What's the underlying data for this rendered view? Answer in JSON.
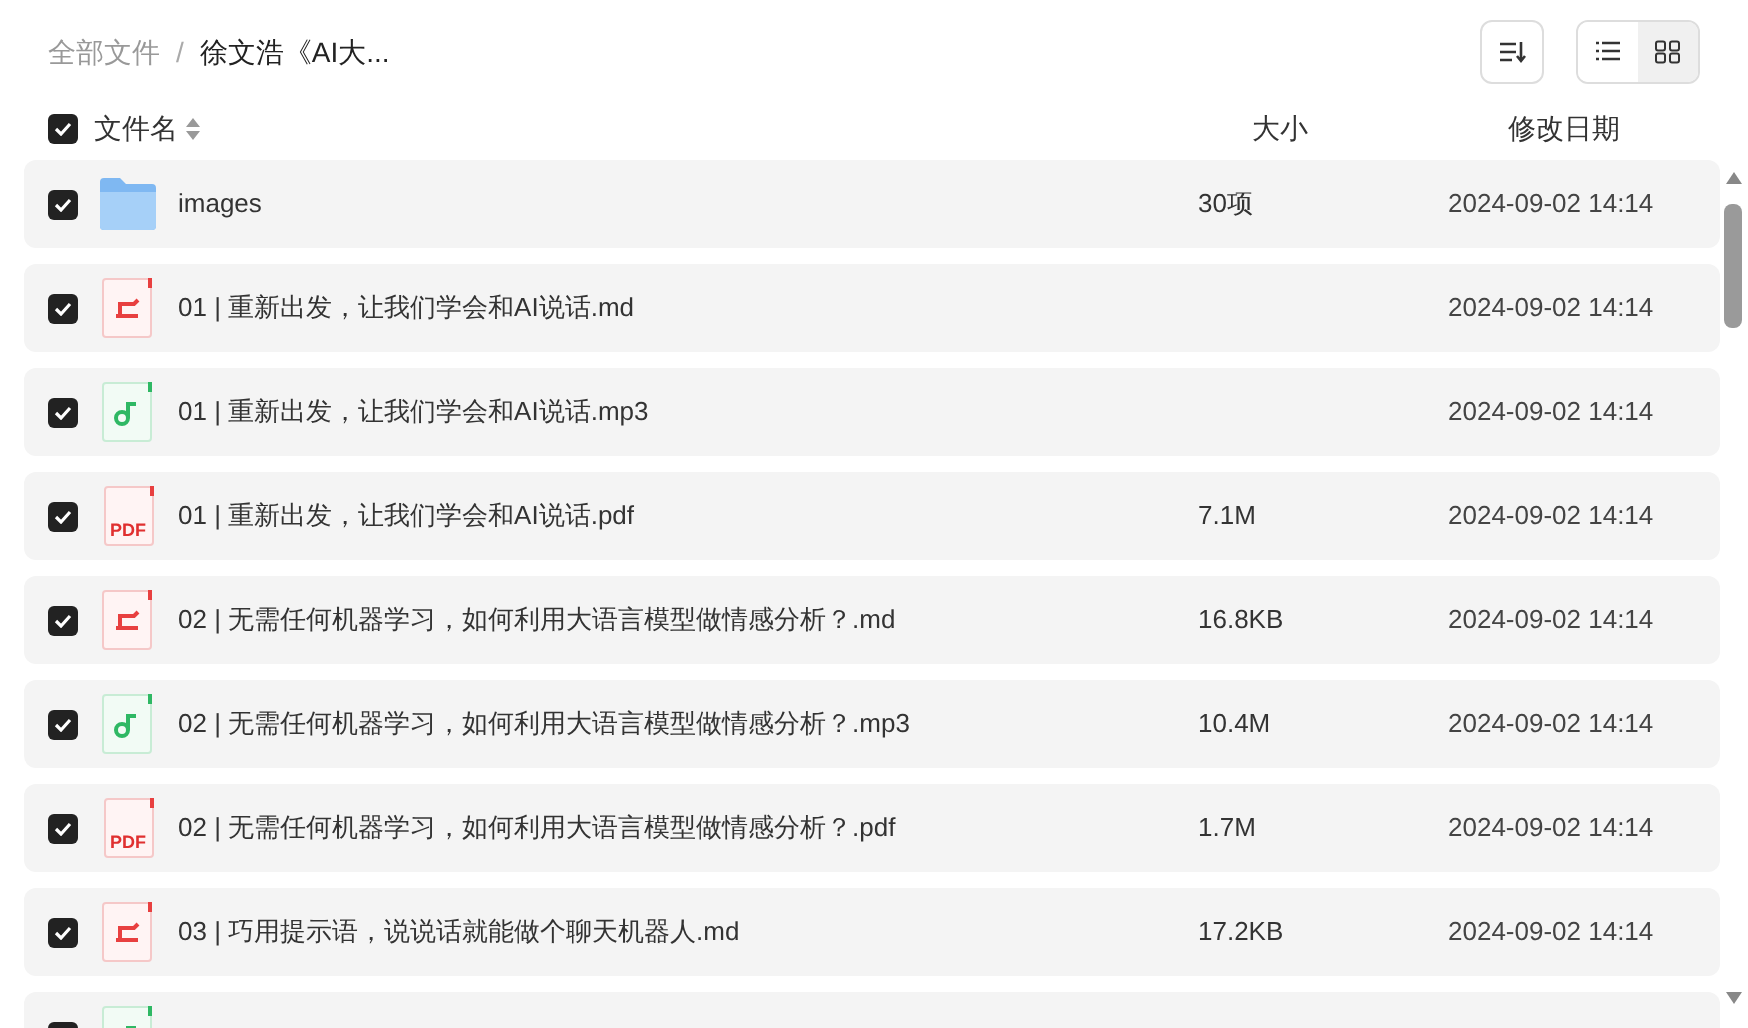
{
  "breadcrumb_separator": "/",
  "breadcrumb": [
    {
      "label": "全部文件",
      "current": false
    },
    {
      "label": "徐文浩《AI大...",
      "current": true
    }
  ],
  "view_modes": [
    {
      "kind": "list",
      "selected": true
    },
    {
      "kind": "grid",
      "selected": false
    }
  ],
  "header": {
    "checked": true,
    "columns": [
      "文件名",
      "大小",
      "修改日期"
    ]
  },
  "rows": [
    {
      "kind": "folder",
      "checked": true,
      "name": "images",
      "size": "30项",
      "date": "2024-09-02 14:14"
    },
    {
      "kind": "md",
      "checked": true,
      "name": "01 | 重新出发，让我们学会和AI说话.md",
      "date": "2024-09-02 14:14"
    },
    {
      "kind": "mp3",
      "checked": true,
      "name": "01 | 重新出发，让我们学会和AI说话.mp3",
      "date": "2024-09-02 14:14"
    },
    {
      "kind": "pdf",
      "checked": true,
      "icon_text": "PDF",
      "name": "01 | 重新出发，让我们学会和AI说话.pdf",
      "size": "7.1M",
      "date": "2024-09-02 14:14"
    },
    {
      "kind": "md",
      "checked": true,
      "name": "02 | 无需任何机器学习，如何利用大语言模型做情感分析？.md",
      "size": "16.8KB",
      "date": "2024-09-02 14:14"
    },
    {
      "kind": "mp3",
      "checked": true,
      "name": "02 | 无需任何机器学习，如何利用大语言模型做情感分析？.mp3",
      "size": "10.4M",
      "date": "2024-09-02 14:14"
    },
    {
      "kind": "pdf",
      "checked": true,
      "icon_text": "PDF",
      "name": "02 | 无需任何机器学习，如何利用大语言模型做情感分析？.pdf",
      "size": "1.7M",
      "date": "2024-09-02 14:14"
    },
    {
      "kind": "md",
      "checked": true,
      "name": "03 | 巧用提示语，说说话就能做个聊天机器人.md",
      "size": "17.2KB",
      "date": "2024-09-02 14:14"
    },
    {
      "kind": "mp3",
      "checked": true
    }
  ]
}
